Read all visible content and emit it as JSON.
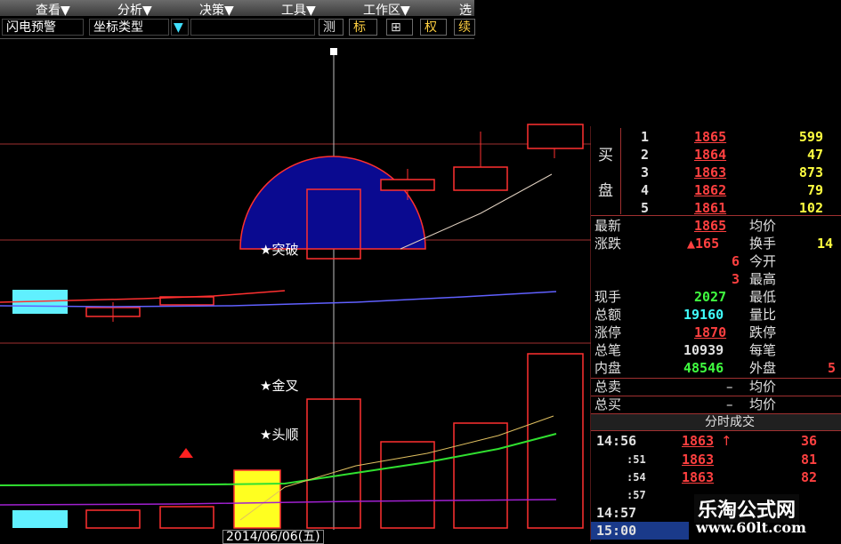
{
  "menu": [
    "查看▼",
    "分析▼",
    "决策▼",
    "工具▼",
    "工作区▼",
    "选"
  ],
  "toolbar": {
    "title": "闪电预警",
    "coord_label": "坐标类型",
    "buttons": [
      "测",
      "标",
      "⊞",
      "权",
      "续"
    ]
  },
  "chart": {
    "labels": {
      "breakout": "★突破",
      "golden_cross": "★金叉",
      "head_shoulder": "★头顺"
    },
    "date": "2014/06/06(五)",
    "colors": {
      "up": "#ff3030",
      "circle": "#0a0a90",
      "ma_blue": "#6060ff",
      "ma_green": "#30e030",
      "ma_yellow": "#e0c060",
      "ma_purple": "#a020d0",
      "cyan": "#60f0ff",
      "vol_yellow": "#ffff20"
    }
  },
  "order_book": {
    "buy_label_1": "买",
    "buy_label_2": "盘",
    "rows": [
      {
        "level": "1",
        "price": "1865",
        "vol": "599"
      },
      {
        "level": "2",
        "price": "1864",
        "vol": "47"
      },
      {
        "level": "3",
        "price": "1863",
        "vol": "873"
      },
      {
        "level": "4",
        "price": "1862",
        "vol": "79"
      },
      {
        "level": "5",
        "price": "1861",
        "vol": "102"
      }
    ]
  },
  "quote": {
    "latest_label": "最新",
    "latest": "1865",
    "avg_label": "均价",
    "change_label": "涨跌",
    "change": "▲165",
    "turnover_label": "换手",
    "turnover": "14",
    "today_open_label": "今开",
    "today_open": "6",
    "high_label": "最高",
    "high": "3",
    "current_hand_label": "现手",
    "current_hand": "2027",
    "low_label": "最低",
    "amount_label": "总额",
    "amount": "19160",
    "vol_ratio_label": "量比",
    "limit_up_label": "涨停",
    "limit_up": "1870",
    "limit_down_label": "跌停",
    "total_trades_label": "总笔",
    "total_trades": "10939",
    "per_trade_label": "每笔",
    "inner_label": "内盘",
    "inner": "48546",
    "outer_label": "外盘",
    "outer": "5",
    "total_sell_label": "总卖",
    "total_sell": "–",
    "avg2_label": "均价",
    "total_buy_label": "总买",
    "total_buy": "–",
    "avg3_label": "均价"
  },
  "tick_header": "分时成交",
  "ticks": [
    {
      "time": "14:56",
      "price": "1863",
      "arrow": "up",
      "vol": "36"
    },
    {
      "time": ":51",
      "price": "1863",
      "arrow": "",
      "vol": "81"
    },
    {
      "time": ":54",
      "price": "1863",
      "arrow": "",
      "vol": "82"
    },
    {
      "time": ":57",
      "price": "",
      "arrow": "",
      "vol": ""
    },
    {
      "time": "14:57",
      "price": "",
      "arrow": "",
      "vol": ""
    },
    {
      "time": "15:00",
      "price": "",
      "arrow": "",
      "vol": ""
    }
  ],
  "watermark": {
    "name": "乐淘公式网",
    "url": "www.60lt.com"
  }
}
